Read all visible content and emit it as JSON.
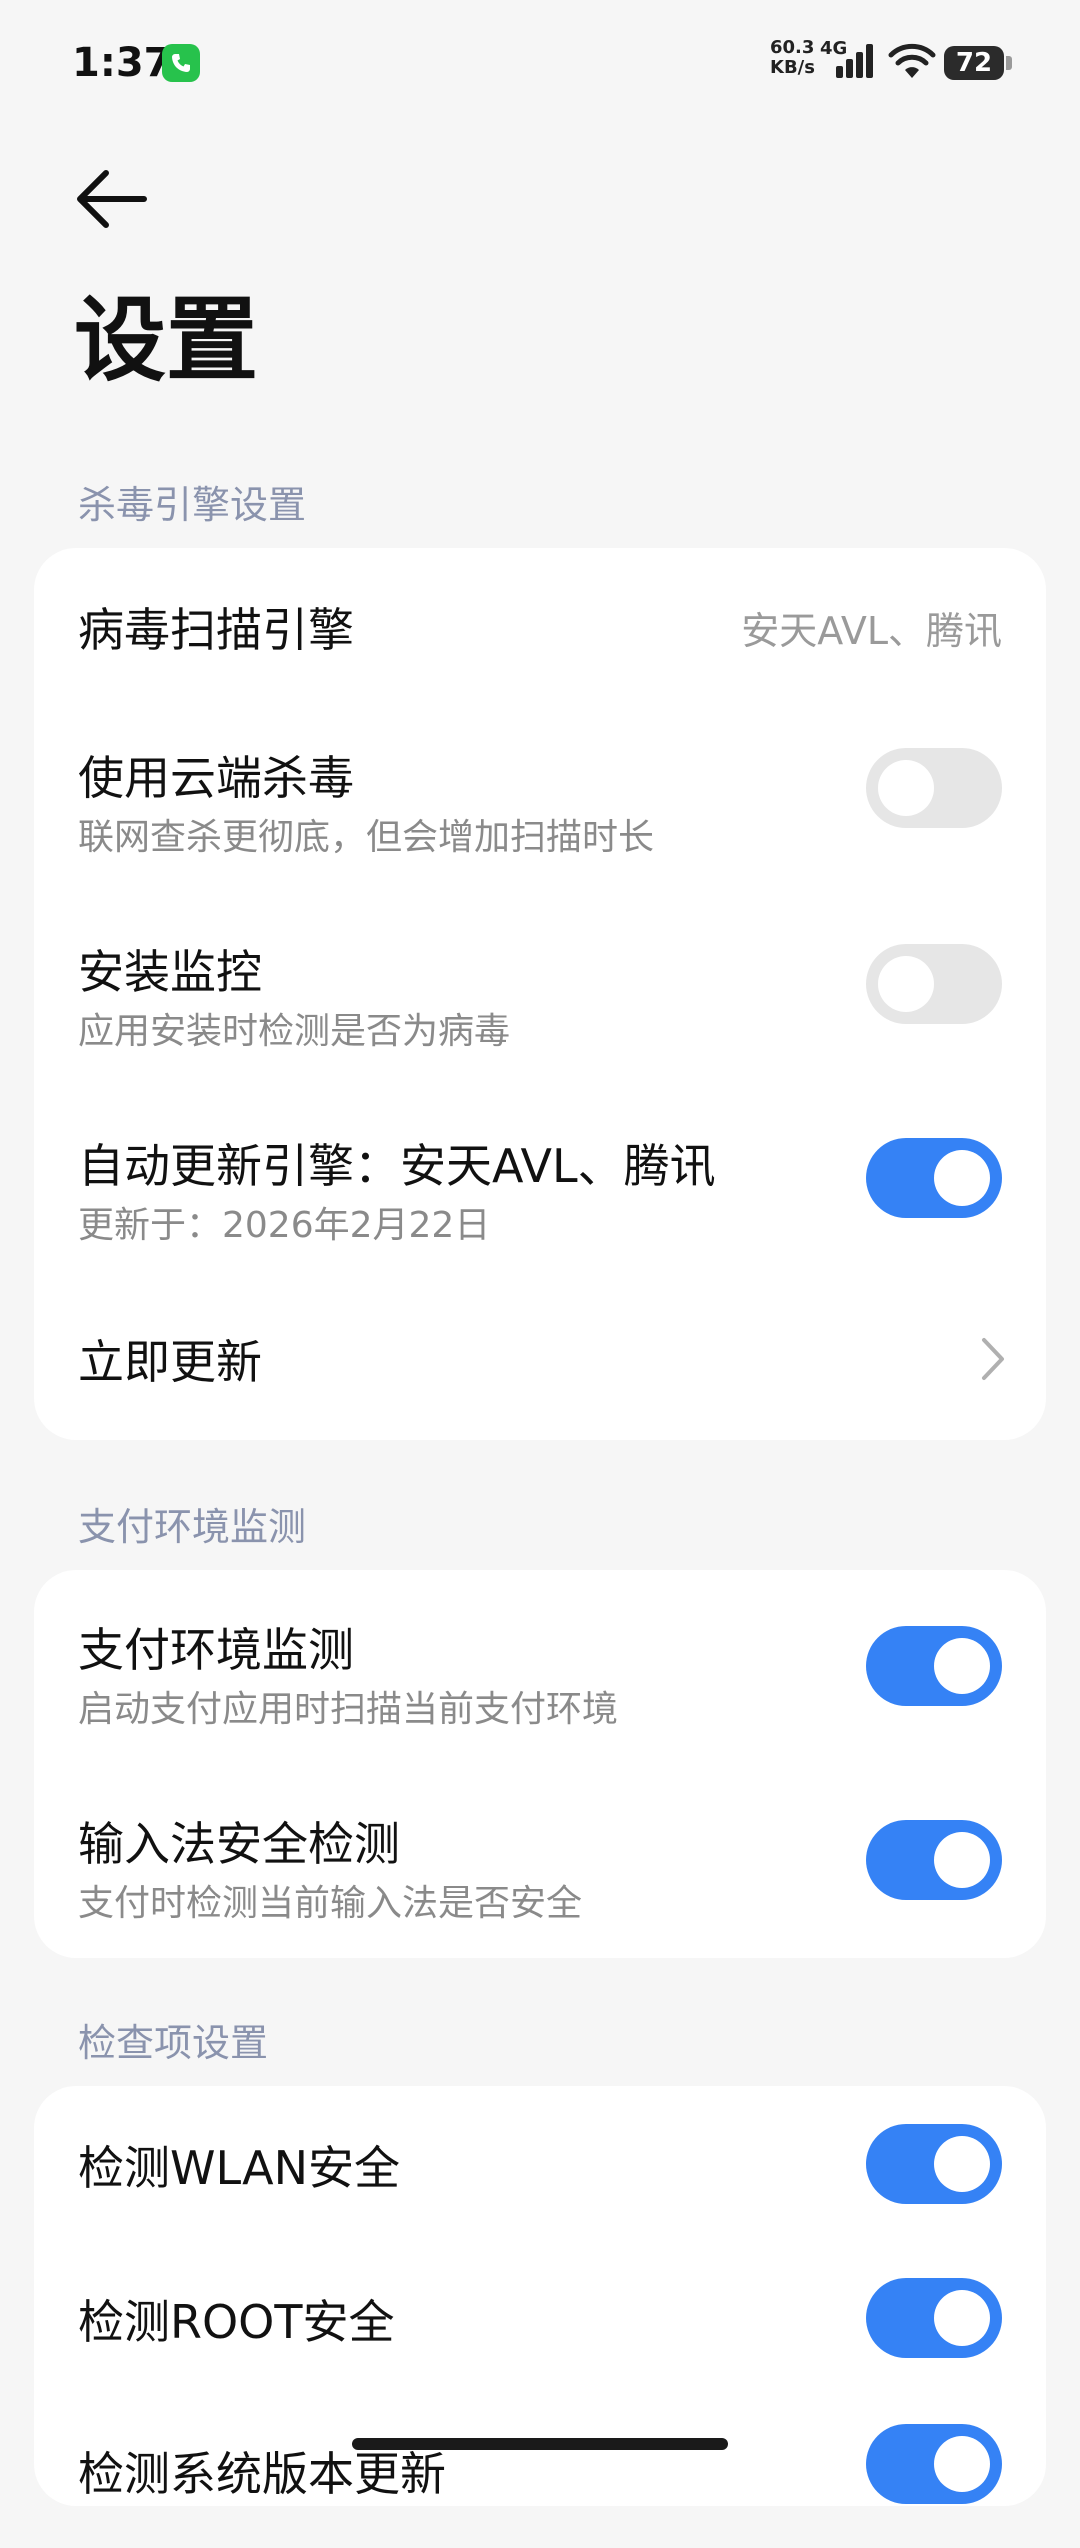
{
  "status": {
    "time": "1:37",
    "net_speed_value": "60.3",
    "net_speed_unit": "KB/s",
    "net_type": "4G",
    "battery": "72"
  },
  "header": {
    "title": "设置"
  },
  "sections": {
    "antivirus": {
      "title": "杀毒引擎设置",
      "engine_label": "病毒扫描引擎",
      "engine_value": "安天AVL、腾讯",
      "cloud_title": "使用云端杀毒",
      "cloud_sub": "联网查杀更彻底，但会增加扫描时长",
      "cloud_on": false,
      "install_title": "安装监控",
      "install_sub": "应用安装时检测是否为病毒",
      "install_on": false,
      "autoupdate_title": "自动更新引擎：安天AVL、腾讯",
      "autoupdate_sub": "更新于：2026年2月22日",
      "autoupdate_on": true,
      "update_now": "立即更新"
    },
    "payment": {
      "title": "支付环境监测",
      "monitor_title": "支付环境监测",
      "monitor_sub": "启动支付应用时扫描当前支付环境",
      "monitor_on": true,
      "ime_title": "输入法安全检测",
      "ime_sub": "支付时检测当前输入法是否安全",
      "ime_on": true
    },
    "checks": {
      "title": "检查项设置",
      "wlan_title": "检测WLAN安全",
      "wlan_on": true,
      "root_title": "检测ROOT安全",
      "root_on": true,
      "sysver_title": "检测系统版本更新",
      "sysver_on": true
    }
  },
  "colors": {
    "accent": "#3582f5",
    "section_title": "#8a93ad",
    "background": "#f6f6f6"
  }
}
